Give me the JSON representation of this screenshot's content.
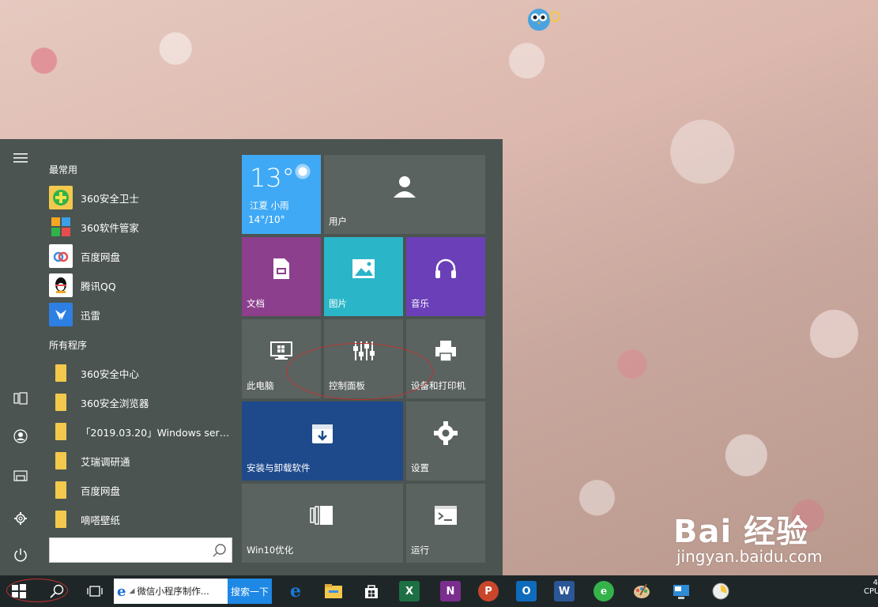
{
  "start_menu": {
    "frequent_title": "最常用",
    "frequent": [
      {
        "label": "360安全卫士",
        "icon": "360-safe-icon",
        "color": "#2fb34a"
      },
      {
        "label": "360软件管家",
        "icon": "360-software-icon",
        "color": "#f5a623"
      },
      {
        "label": "百度网盘",
        "icon": "baidu-netdisk-icon",
        "color": "#3a8ee6"
      },
      {
        "label": "腾讯QQ",
        "icon": "qq-penguin-icon",
        "color": "#111111"
      },
      {
        "label": "迅雷",
        "icon": "thunder-icon",
        "color": "#2d7fe3"
      }
    ],
    "all_title": "所有程序",
    "all": [
      {
        "label": "360安全中心"
      },
      {
        "label": "360安全浏览器"
      },
      {
        "label": "「2019.03.20」Windows server..."
      },
      {
        "label": "艾瑞调研通"
      },
      {
        "label": "百度网盘"
      },
      {
        "label": "嘀嗒壁纸"
      }
    ],
    "search_value": "",
    "tiles": {
      "weather": {
        "temp": "13°",
        "location": "江夏 小雨",
        "range": "14°/10°",
        "color": "#3fa9f5"
      },
      "user": {
        "label": "用户"
      },
      "docs": {
        "label": "文档",
        "color": "#8c3f8c"
      },
      "pictures": {
        "label": "图片",
        "color": "#2bb5c8"
      },
      "music": {
        "label": "音乐",
        "color": "#6a3fb8"
      },
      "pc": {
        "label": "此电脑"
      },
      "control": {
        "label": "控制面板"
      },
      "devices": {
        "label": "设备和打印机"
      },
      "uninstall": {
        "label": "安装与卸载软件",
        "color": "#1e4a8c"
      },
      "settings": {
        "label": "设置"
      },
      "win10": {
        "label": "Win10优化"
      },
      "run": {
        "label": "运行"
      }
    }
  },
  "taskbar": {
    "ie_title": "微信小程序制作...",
    "search_btn": "搜索一下",
    "ie_glyph": "e",
    "apps": [
      {
        "icon": "edge-icon",
        "glyph": "e",
        "color": "#1c78d6"
      },
      {
        "icon": "file-explorer-icon",
        "glyph": "",
        "color": "#f2c94c"
      },
      {
        "icon": "store-icon",
        "glyph": "",
        "color": "#ffffff"
      },
      {
        "icon": "excel-icon",
        "glyph": "X",
        "color": "#1d7044"
      },
      {
        "icon": "onenote-icon",
        "glyph": "N",
        "color": "#7b2e8e"
      },
      {
        "icon": "powerpoint-icon",
        "glyph": "P",
        "color": "#c9462b"
      },
      {
        "icon": "outlook-icon",
        "glyph": "O",
        "color": "#0f6cbd"
      },
      {
        "icon": "word-icon",
        "glyph": "W",
        "color": "#2b5797"
      },
      {
        "icon": "360-browser-icon",
        "glyph": "e",
        "color": "#35b24a"
      },
      {
        "icon": "paint-icon",
        "glyph": "",
        "color": "#e0a040"
      },
      {
        "icon": "remote-desktop-icon",
        "glyph": "",
        "color": "#2e8bd6"
      },
      {
        "icon": "clock-icon",
        "glyph": "",
        "color": "#dddddd"
      }
    ],
    "tray_text": "4",
    "tray_sub": "CPU"
  },
  "watermark": {
    "brand": "Bai  经验",
    "url": "jingyan.baidu.com"
  }
}
